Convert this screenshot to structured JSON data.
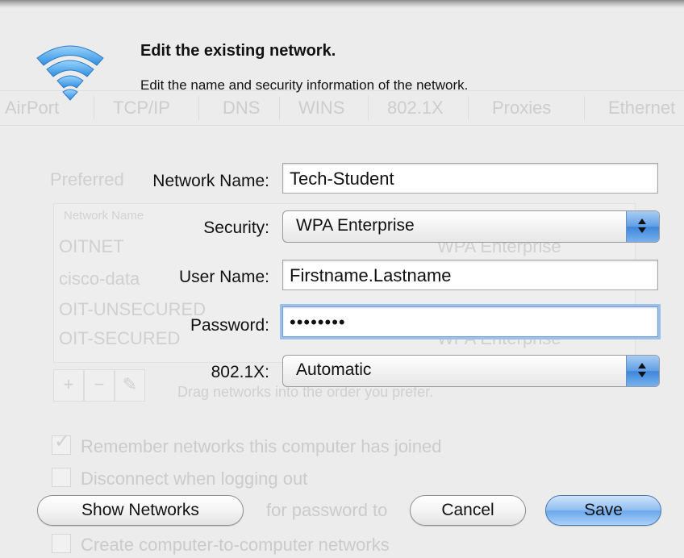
{
  "dialog": {
    "title": "Edit the existing network.",
    "subtitle": "Edit the name and security information of the network.",
    "fields": {
      "network_name": {
        "label": "Network Name:",
        "value": "Tech-Student"
      },
      "security": {
        "label": "Security:",
        "value": "WPA Enterprise"
      },
      "user_name": {
        "label": "User Name:",
        "value": "Firstname.Lastname"
      },
      "password": {
        "label": "Password:",
        "value": "••••••••"
      },
      "dot1x": {
        "label": "802.1X:",
        "value": "Automatic"
      }
    },
    "buttons": {
      "show_networks": "Show Networks",
      "cancel": "Cancel",
      "save": "Save"
    },
    "accent_color": "#5e9ee4"
  },
  "background": {
    "tabs": [
      "AirPort",
      "TCP/IP",
      "DNS",
      "WINS",
      "802.1X",
      "Proxies",
      "Ethernet"
    ],
    "preferred_label": "Preferred",
    "list_header": "Network Name",
    "networks": [
      "OITNET",
      "cisco-data",
      "OIT-UNSECURED",
      "OIT-SECURED"
    ],
    "network_security": "WPA Enterprise",
    "drag_hint": "Drag networks into the order you prefer.",
    "checkboxes": [
      {
        "label": "Remember networks this computer has joined",
        "checked": true
      },
      {
        "label": "Disconnect when logging out",
        "checked": false
      },
      {
        "label": "for password to",
        "checked": false
      },
      {
        "label": "Create computer-to-computer networks",
        "checked": false
      }
    ]
  }
}
